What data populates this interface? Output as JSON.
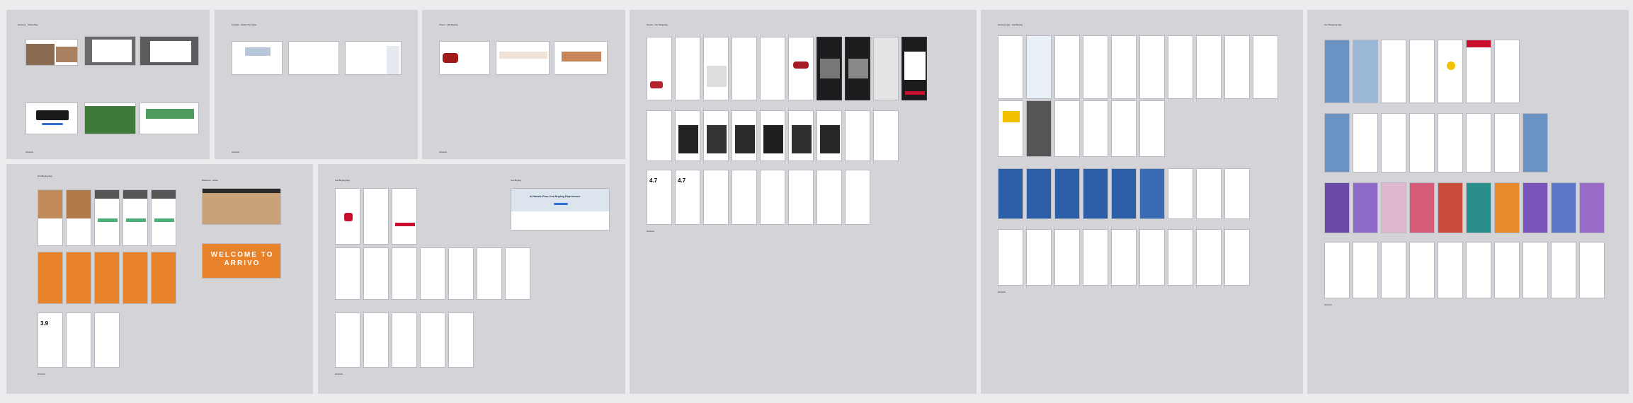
{
  "canvas": {
    "background": "#ececee",
    "board_color": "#d3d3d8",
    "accent_blue": "#2f6fd6",
    "accent_orange": "#e8822b",
    "accent_red": "#c8102e",
    "accent_green": "#2f8f4e"
  },
  "boards": {
    "b1": {
      "title": "Carvana · Online Buy",
      "notes": [
        "Artboards"
      ]
    },
    "b2": {
      "title": "CarMax · Online Purchase",
      "notes": [
        "Artboards"
      ]
    },
    "b3": {
      "title": "Vroom · Car Buying",
      "notes": [
        "Artboards"
      ]
    },
    "b4": {
      "title": "Toyota · Car Shopping",
      "hero_rating": "4.7",
      "hero_rating2": "4.7",
      "notes": [
        "Artboards"
      ]
    },
    "b5": {
      "title": "Carvana App · Car Buying",
      "notes": [
        "Artboards"
      ]
    },
    "b6": {
      "title": "Car Shopping App",
      "notes": [
        "Artboards"
      ]
    },
    "b7": {
      "title": "Car Buying App",
      "rating": "3.9",
      "notes": [
        "Artboards"
      ]
    },
    "b8": {
      "title": "Welcome · Arrivo",
      "welcome_text": "WELCOME TO ARRIVO",
      "notes": []
    },
    "b9": {
      "title": "Car Buying App",
      "notes": [
        "Artboards"
      ]
    },
    "b10": {
      "title": "Car Buying",
      "hero_heading": "A Hassle-Free Car Buying Experience",
      "notes": []
    }
  }
}
